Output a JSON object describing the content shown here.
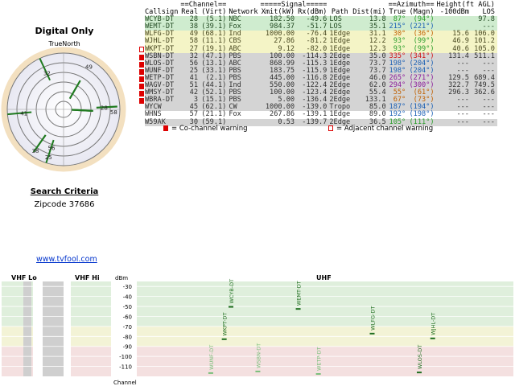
{
  "left": {
    "title": "Digital Only",
    "truenorth": "TrueNorth",
    "search_title": "Search Criteria",
    "zip_line": "Zipcode 37686",
    "link": "www.tvfool.com"
  },
  "table": {
    "group_headers": [
      "==Channel==",
      "=====Signal=====",
      "==Azimuth==",
      "Height(ft AGL)"
    ],
    "headers": [
      "Callsign",
      "Real",
      "(Virt)",
      "Network",
      "Xmit(kW)",
      "Rx(dBm)",
      "Path",
      "Dist(mi)",
      "True",
      "(Magn)",
      "-100dBm",
      "LOS"
    ],
    "rows": [
      {
        "callsign": "WCYB-DT",
        "real": "28",
        "virt": "(5.1)",
        "network": "NBC",
        "xmit": "182.50",
        "rx": "-49.6",
        "path": "LOS",
        "dist": "13.8",
        "true": "87°",
        "magn": "(94°)",
        "h100": "",
        "hlos": "97.8",
        "color": "green",
        "warn": "",
        "az_color": "#2a9d2a"
      },
      {
        "callsign": "WEMT-DT",
        "real": "38",
        "virt": "(39.1)",
        "network": "Fox",
        "xmit": "984.37",
        "rx": "-51.7",
        "path": "LOS",
        "dist": "35.1",
        "true": "215°",
        "magn": "(221°)",
        "h100": "",
        "hlos": "---",
        "color": "green",
        "warn": "",
        "az_color": "#1a5fb4"
      },
      {
        "callsign": "WLFG-DT",
        "real": "49",
        "virt": "(68.1)",
        "network": "Ind",
        "xmit": "1000.00",
        "rx": "-76.4",
        "path": "1Edge",
        "dist": "31.1",
        "true": "30°",
        "magn": "(36°)",
        "h100": "15.6",
        "hlos": "106.0",
        "color": "yellow",
        "warn": "",
        "az_color": "#c06000"
      },
      {
        "callsign": "WJHL-DT",
        "real": "58",
        "virt": "(11.1)",
        "network": "CBS",
        "xmit": "27.86",
        "rx": "-81.2",
        "path": "1Edge",
        "dist": "12.2",
        "true": "93°",
        "magn": "(99°)",
        "h100": "46.9",
        "hlos": "101.2",
        "color": "yellow",
        "warn": "",
        "az_color": "#2a9d2a"
      },
      {
        "callsign": "WKPT-DT",
        "real": "27",
        "virt": "(19.1)",
        "network": "ABC",
        "xmit": "9.12",
        "rx": "-82.0",
        "path": "1Edge",
        "dist": "12.3",
        "true": "93°",
        "magn": "(99°)",
        "h100": "40.6",
        "hlos": "105.0",
        "color": "yellow",
        "warn": "adj",
        "az_color": "#2a9d2a"
      },
      {
        "callsign": "WSBN-DT",
        "real": "32",
        "virt": "(47.1)",
        "network": "PBS",
        "xmit": "100.00",
        "rx": "-114.3",
        "path": "2Edge",
        "dist": "35.0",
        "true": "335°",
        "magn": "(341°)",
        "h100": "131.4",
        "hlos": "511.1",
        "color": "gray",
        "warn": "co",
        "az_color": "#d01010"
      },
      {
        "callsign": "WLOS-DT",
        "real": "56",
        "virt": "(13.1)",
        "network": "ABC",
        "xmit": "868.99",
        "rx": "-115.3",
        "path": "1Edge",
        "dist": "73.7",
        "true": "198°",
        "magn": "(204°)",
        "h100": "---",
        "hlos": "---",
        "color": "gray",
        "warn": "co",
        "az_color": "#1a5fb4"
      },
      {
        "callsign": "WUNF-DT",
        "real": "25",
        "virt": "(33.1)",
        "network": "PBS",
        "xmit": "183.75",
        "rx": "-115.9",
        "path": "1Edge",
        "dist": "73.7",
        "true": "198°",
        "magn": "(204°)",
        "h100": "---",
        "hlos": "---",
        "color": "gray",
        "warn": "co",
        "az_color": "#1a5fb4"
      },
      {
        "callsign": "WETP-DT",
        "real": "41",
        "virt": "(2.1)",
        "network": "PBS",
        "xmit": "445.00",
        "rx": "-116.8",
        "path": "2Edge",
        "dist": "46.0",
        "true": "265°",
        "magn": "(271°)",
        "h100": "129.5",
        "hlos": "689.4",
        "color": "gray",
        "warn": "co",
        "az_color": "#8a1a9a"
      },
      {
        "callsign": "WAGV-DT",
        "real": "51",
        "virt": "(44.1)",
        "network": "Ind",
        "xmit": "550.00",
        "rx": "-122.4",
        "path": "2Edge",
        "dist": "62.0",
        "true": "294°",
        "magn": "(300°)",
        "h100": "322.7",
        "hlos": "749.5",
        "color": "gray",
        "warn": "co",
        "az_color": "#8a1a9a"
      },
      {
        "callsign": "WMSY-DT",
        "real": "42",
        "virt": "(52.1)",
        "network": "PBS",
        "xmit": "100.00",
        "rx": "-123.4",
        "path": "2Edge",
        "dist": "55.4",
        "true": "55°",
        "magn": "(61°)",
        "h100": "296.3",
        "hlos": "362.6",
        "color": "gray",
        "warn": "co",
        "az_color": "#c06000"
      },
      {
        "callsign": "WBRA-DT",
        "real": "3",
        "virt": "(15.1)",
        "network": "PBS",
        "xmit": "5.00",
        "rx": "-136.4",
        "path": "2Edge",
        "dist": "133.1",
        "true": "67°",
        "magn": "(73°)",
        "h100": "---",
        "hlos": "---",
        "color": "gray",
        "warn": "co",
        "az_color": "#c06000"
      },
      {
        "callsign": "WYCW",
        "real": "45",
        "virt": "(62.1)",
        "network": "CW",
        "xmit": "1000.00",
        "rx": "-139.0",
        "path": "Tropo",
        "dist": "85.0",
        "true": "187°",
        "magn": "(194°)",
        "h100": "---",
        "hlos": "---",
        "color": "gray",
        "warn": "",
        "az_color": "#1a5fb4"
      },
      {
        "callsign": "WHNS",
        "real": "57",
        "virt": "(21.1)",
        "network": "Fox",
        "xmit": "267.86",
        "rx": "-139.1",
        "path": "1Edge",
        "dist": "89.0",
        "true": "192°",
        "magn": "(198°)",
        "h100": "---",
        "hlos": "---",
        "color": "white",
        "warn": "",
        "az_color": "#1a5fb4"
      },
      {
        "callsign": "W59AK",
        "real": "30",
        "virt": "(59.1)",
        "network": "",
        "xmit": "0.53",
        "rx": "-139.7",
        "path": "2Edge",
        "dist": "36.5",
        "true": "105°",
        "magn": "(111°)",
        "h100": "---",
        "hlos": "---",
        "color": "gray",
        "warn": "",
        "az_color": "#2a9d2a"
      }
    ],
    "legend_co": "= Co-channel warning",
    "legend_adj": "= Adjacent channel warning",
    "warn_co_text": "C",
    "warn_adj_text": "A"
  },
  "polar": {
    "labels": [
      {
        "text": "32",
        "deg": 335
      },
      {
        "text": "49",
        "deg": 30
      },
      {
        "text": "28",
        "deg": 87
      },
      {
        "text": "58",
        "deg": 93
      },
      {
        "text": "41",
        "deg": 265
      },
      {
        "text": "38",
        "deg": 215
      },
      {
        "text": "56",
        "deg": 198
      },
      {
        "text": "25",
        "deg": 198
      }
    ]
  },
  "spectrum": {
    "vhf_lo_label": "VHF Lo",
    "vhf_hi_label": "VHF Hi",
    "uhf_label": "UHF",
    "dbm_label": "dBm",
    "channel_label": "Channel",
    "yticks": [
      "-30",
      "-40",
      "-50",
      "-60",
      "-70",
      "-80",
      "-90",
      "-100",
      "-110"
    ],
    "stations": [
      {
        "callsign": "WCYB-DT",
        "channel": 28,
        "dbm": -49.6,
        "strong": true
      },
      {
        "callsign": "WEMT-DT",
        "channel": 38,
        "dbm": -51.7,
        "strong": true
      },
      {
        "callsign": "WLFG-DT",
        "channel": 49,
        "dbm": -76.4,
        "strong": true
      },
      {
        "callsign": "WJHL-DT",
        "channel": 58,
        "dbm": -81.2,
        "strong": true
      },
      {
        "callsign": "WKPT-DT",
        "channel": 27,
        "dbm": -82.0,
        "strong": true
      },
      {
        "callsign": "WLOS-DT",
        "channel": 56,
        "dbm": -115.3,
        "strong": true
      },
      {
        "callsign": "WUNF-DT",
        "channel": 25,
        "dbm": -115.9,
        "strong": false
      },
      {
        "callsign": "WSBN-DT",
        "channel": 32,
        "dbm": -114.3,
        "strong": false
      },
      {
        "callsign": "WETP-DT",
        "channel": 41,
        "dbm": -116.8,
        "strong": false
      }
    ]
  }
}
